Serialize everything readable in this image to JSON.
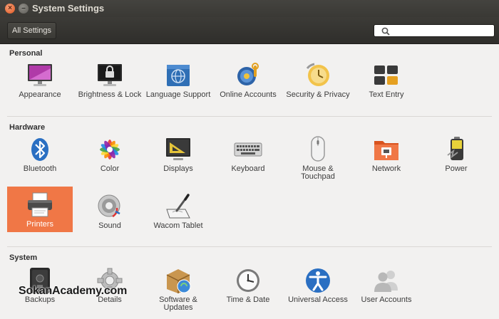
{
  "window": {
    "title": "System Settings",
    "close_glyph": "×",
    "minimize_glyph": "–"
  },
  "toolbar": {
    "all_settings_label": "All Settings",
    "search_placeholder": "",
    "search_value": ""
  },
  "sections": {
    "personal": {
      "title": "Personal",
      "items": {
        "appearance": "Appearance",
        "brightness": "Brightness & Lock",
        "language": "Language Support",
        "online_accounts": "Online Accounts",
        "security": "Security & Privacy",
        "text_entry": "Text Entry"
      }
    },
    "hardware": {
      "title": "Hardware",
      "items": {
        "bluetooth": "Bluetooth",
        "color": "Color",
        "displays": "Displays",
        "keyboard": "Keyboard",
        "mouse": "Mouse & Touchpad",
        "network": "Network",
        "power": "Power",
        "printers": "Printers",
        "sound": "Sound",
        "wacom": "Wacom Tablet"
      }
    },
    "system": {
      "title": "System",
      "items": {
        "backups": "Backups",
        "details": "Details",
        "software": "Software & Updates",
        "time_date": "Time & Date",
        "universal_access": "Universal Access",
        "user_accounts": "User Accounts"
      }
    }
  },
  "selected_item": "Printers",
  "watermark": "SokanAcademy.com",
  "colors": {
    "accent": "#f07746",
    "titlebar": "#3c3b37",
    "background": "#f2f1f0"
  }
}
